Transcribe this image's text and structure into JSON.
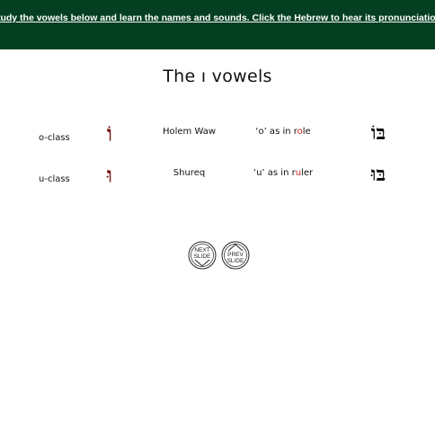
{
  "banner": {
    "instruction": "Study the vowels below and learn the names and sounds. Click the Hebrew to hear its pronunciation."
  },
  "heading": {
    "prefix": "The",
    "letter": "ו",
    "suffix": "vowels"
  },
  "vowels": [
    {
      "class": "o-class",
      "symbol": "וֹ",
      "name": "Holem Waw",
      "sound_pre": "‘o’ as in r",
      "sound_hl": "o",
      "sound_post": "le",
      "example": "בּוֹ"
    },
    {
      "class": "u-class",
      "symbol": "וּ",
      "name": "Shureq",
      "sound_pre": "‘u’ as in r",
      "sound_hl": "u",
      "sound_post": "ler",
      "example": "בּוּ"
    }
  ],
  "nav": {
    "next_line1": "NEXT",
    "next_line2": "SLIDE",
    "prev_line1": "PREV",
    "prev_line2": "SLIDE"
  },
  "colors": {
    "banner_bg": "#043f22",
    "vowel": "#7a1412",
    "highlight": "#d0211c"
  }
}
